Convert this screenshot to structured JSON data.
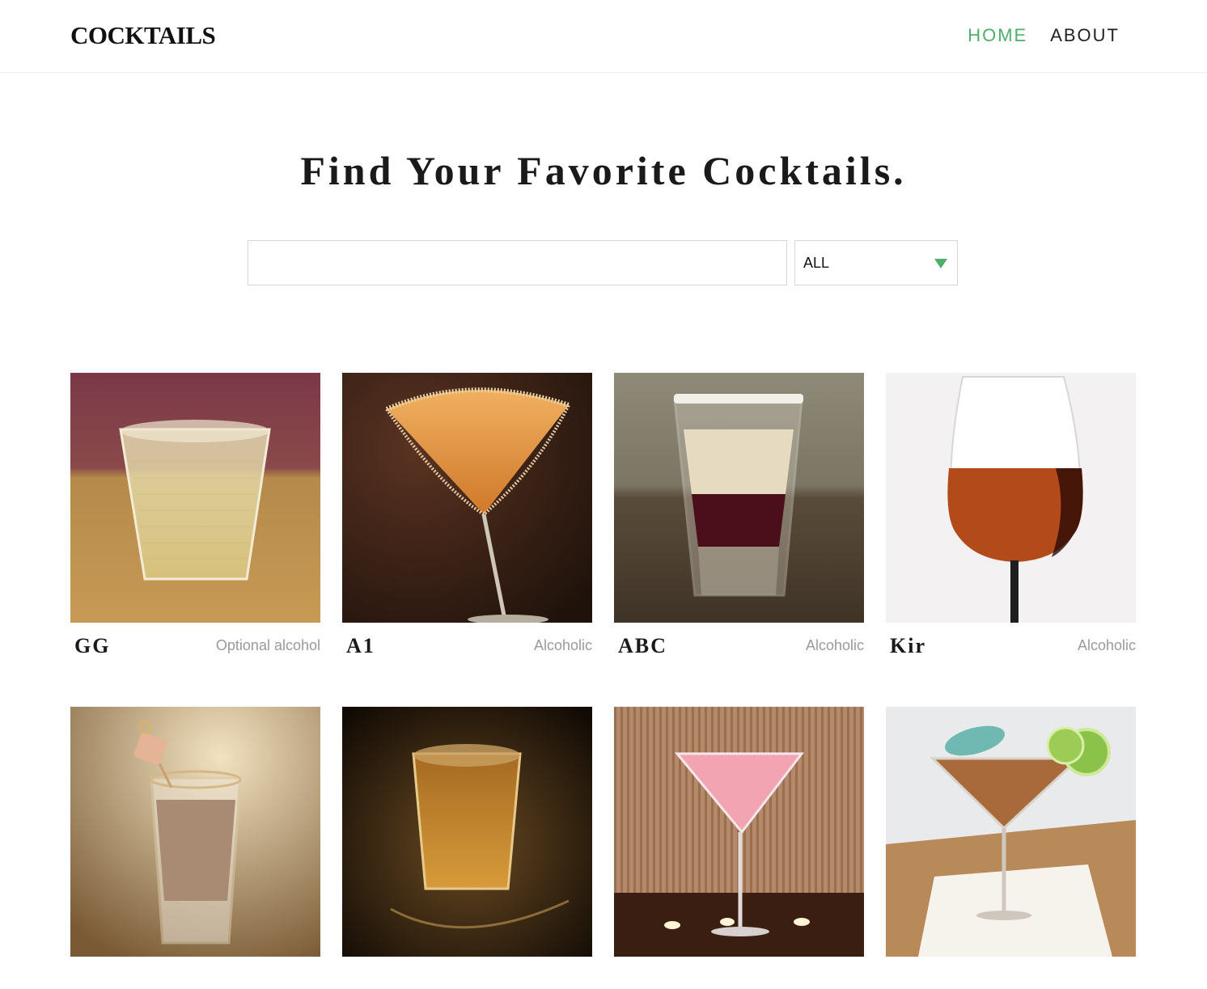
{
  "header": {
    "logo": "COCKTAILS",
    "nav": [
      {
        "label": "HOME",
        "active": true
      },
      {
        "label": "ABOUT",
        "active": false
      }
    ]
  },
  "hero": {
    "title": "Find Your Favorite Cocktails."
  },
  "search": {
    "value": "",
    "placeholder": "",
    "filter_value": "ALL"
  },
  "colors": {
    "accent": "#4caf6a",
    "muted_text": "#9a9a9a"
  },
  "cocktails": [
    {
      "name": "GG",
      "type": "Optional alcohol",
      "image": "rocks-glass-yellow-drink"
    },
    {
      "name": "A1",
      "type": "Alcoholic",
      "image": "martini-glass-orange-drink"
    },
    {
      "name": "ABC",
      "type": "Alcoholic",
      "image": "shot-glass-layered-drink"
    },
    {
      "name": "Kir",
      "type": "Alcoholic",
      "image": "wine-glass-red-drink"
    },
    {
      "name": "",
      "type": "",
      "image": "shot-glass-cream-drink"
    },
    {
      "name": "",
      "type": "",
      "image": "shot-glass-whiskey-drink"
    },
    {
      "name": "",
      "type": "",
      "image": "martini-glass-pink-drink"
    },
    {
      "name": "",
      "type": "",
      "image": "martini-glass-lime-garnish-drink"
    }
  ]
}
